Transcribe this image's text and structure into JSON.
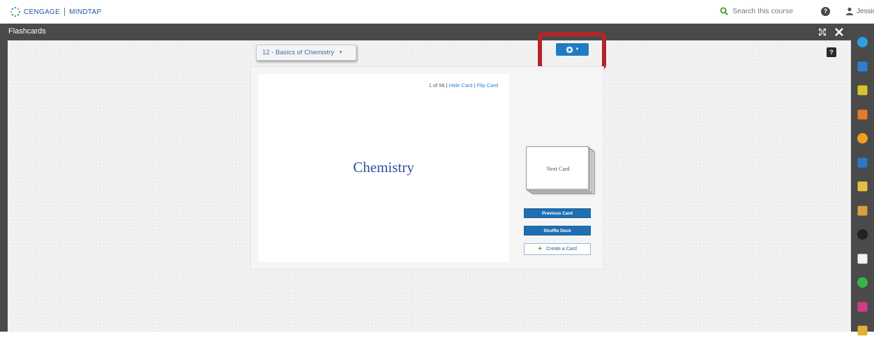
{
  "header": {
    "brand": "CENGAGE",
    "product": "MINDTAP",
    "search_label": "Search this course",
    "help_icon": "help-circle-icon",
    "user_name": "Jessica",
    "user_chevron": "v"
  },
  "window": {
    "title": "Flashcards",
    "expand_icon": "expand-icon",
    "close_icon": "close-icon",
    "help_label": "?"
  },
  "deck": {
    "selected": "12 - Basics of Chemistry",
    "chevron": "▼"
  },
  "settings": {
    "icon": "gear-icon",
    "caret": "▼",
    "highlight_color": "#b3242b"
  },
  "card": {
    "position": "1 of 56",
    "separator": "|",
    "hide_label": "Hide Card",
    "flip_label": "Flip Card",
    "term": "Chemistry"
  },
  "controls": {
    "next_label": "Next Card",
    "previous_label": "Previous Card",
    "shuffle_label": "Shuffle Deck",
    "create_label": "Create a Card"
  },
  "dock": {
    "items": [
      {
        "name": "dock-app-1",
        "icon": "bubble-icon",
        "color": "#2d9ee0"
      },
      {
        "name": "dock-app-2",
        "icon": "briefcase-icon",
        "color": "#2d7fd0"
      },
      {
        "name": "dock-app-3",
        "icon": "pencil-icon",
        "color": "#d8c431"
      },
      {
        "name": "dock-app-4",
        "icon": "rss-icon",
        "color": "#e8792a"
      },
      {
        "name": "dock-app-5",
        "icon": "flame-icon",
        "color": "#f0a020"
      },
      {
        "name": "dock-app-6",
        "icon": "book-icon",
        "color": "#2a78c4"
      },
      {
        "name": "dock-app-7",
        "icon": "notepad-icon",
        "color": "#e8c040"
      },
      {
        "name": "dock-app-8",
        "icon": "pen-icon",
        "color": "#d6a040"
      },
      {
        "name": "dock-app-9",
        "icon": "m-circle-icon",
        "color": "#222222"
      },
      {
        "name": "dock-app-10",
        "icon": "chat-icon",
        "color": "#f2f2f2"
      },
      {
        "name": "dock-app-11",
        "icon": "s-circle-icon",
        "color": "#3ab44a"
      },
      {
        "name": "dock-app-12",
        "icon": "monitor-icon",
        "color": "#d23a8a"
      },
      {
        "name": "dock-app-13",
        "icon": "az-icon",
        "color": "#e0b030"
      }
    ]
  }
}
